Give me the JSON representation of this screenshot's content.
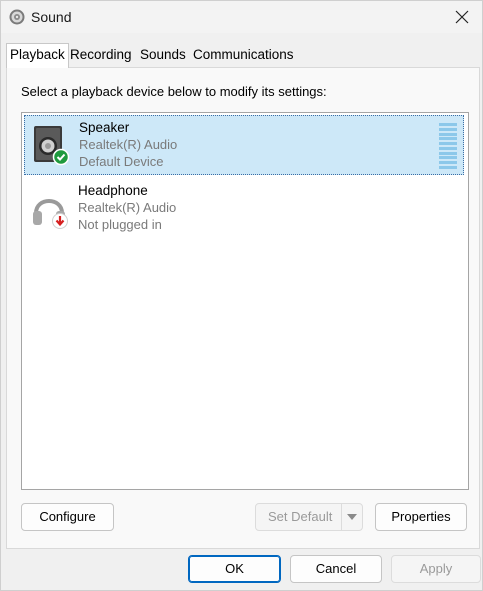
{
  "window": {
    "title": "Sound",
    "app_icon": "speaker-icon",
    "close_icon": "close-icon"
  },
  "tabs": [
    {
      "label": "Playback",
      "active": true
    },
    {
      "label": "Recording",
      "active": false
    },
    {
      "label": "Sounds",
      "active": false
    },
    {
      "label": "Communications",
      "active": false
    }
  ],
  "playback": {
    "instruction": "Select a playback device below to modify its settings:",
    "devices": [
      {
        "name": "Speaker",
        "driver": "Realtek(R) Audio",
        "status": "Default Device",
        "icon": "speaker-device-icon",
        "badge": "green-check-icon",
        "selected": true
      },
      {
        "name": "Headphone",
        "driver": "Realtek(R) Audio",
        "status": "Not plugged in",
        "icon": "headphone-device-icon",
        "badge": "red-down-arrow-icon",
        "selected": false
      }
    ],
    "buttons": {
      "configure": "Configure",
      "set_default": "Set Default",
      "properties": "Properties"
    }
  },
  "dialog_buttons": {
    "ok": "OK",
    "cancel": "Cancel",
    "apply": "Apply"
  },
  "colors": {
    "selection": "#cde8f8",
    "accent": "#0067c0"
  }
}
